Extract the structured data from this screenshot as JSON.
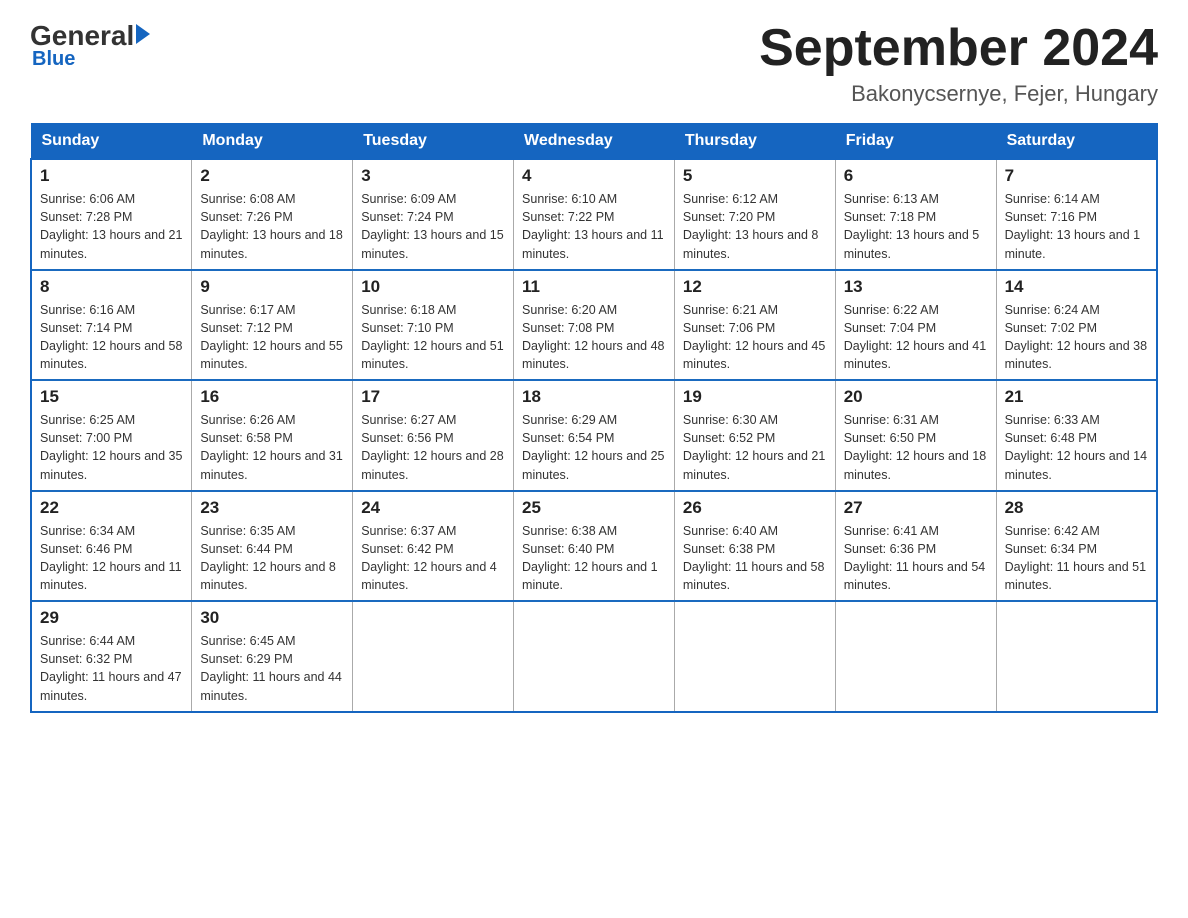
{
  "header": {
    "logo_main": "General",
    "logo_sub": "Blue",
    "title": "September 2024",
    "location": "Bakonycsernye, Fejer, Hungary"
  },
  "weekdays": [
    "Sunday",
    "Monday",
    "Tuesday",
    "Wednesday",
    "Thursday",
    "Friday",
    "Saturday"
  ],
  "weeks": [
    [
      {
        "day": "1",
        "sunrise": "6:06 AM",
        "sunset": "7:28 PM",
        "daylight": "13 hours and 21 minutes."
      },
      {
        "day": "2",
        "sunrise": "6:08 AM",
        "sunset": "7:26 PM",
        "daylight": "13 hours and 18 minutes."
      },
      {
        "day": "3",
        "sunrise": "6:09 AM",
        "sunset": "7:24 PM",
        "daylight": "13 hours and 15 minutes."
      },
      {
        "day": "4",
        "sunrise": "6:10 AM",
        "sunset": "7:22 PM",
        "daylight": "13 hours and 11 minutes."
      },
      {
        "day": "5",
        "sunrise": "6:12 AM",
        "sunset": "7:20 PM",
        "daylight": "13 hours and 8 minutes."
      },
      {
        "day": "6",
        "sunrise": "6:13 AM",
        "sunset": "7:18 PM",
        "daylight": "13 hours and 5 minutes."
      },
      {
        "day": "7",
        "sunrise": "6:14 AM",
        "sunset": "7:16 PM",
        "daylight": "13 hours and 1 minute."
      }
    ],
    [
      {
        "day": "8",
        "sunrise": "6:16 AM",
        "sunset": "7:14 PM",
        "daylight": "12 hours and 58 minutes."
      },
      {
        "day": "9",
        "sunrise": "6:17 AM",
        "sunset": "7:12 PM",
        "daylight": "12 hours and 55 minutes."
      },
      {
        "day": "10",
        "sunrise": "6:18 AM",
        "sunset": "7:10 PM",
        "daylight": "12 hours and 51 minutes."
      },
      {
        "day": "11",
        "sunrise": "6:20 AM",
        "sunset": "7:08 PM",
        "daylight": "12 hours and 48 minutes."
      },
      {
        "day": "12",
        "sunrise": "6:21 AM",
        "sunset": "7:06 PM",
        "daylight": "12 hours and 45 minutes."
      },
      {
        "day": "13",
        "sunrise": "6:22 AM",
        "sunset": "7:04 PM",
        "daylight": "12 hours and 41 minutes."
      },
      {
        "day": "14",
        "sunrise": "6:24 AM",
        "sunset": "7:02 PM",
        "daylight": "12 hours and 38 minutes."
      }
    ],
    [
      {
        "day": "15",
        "sunrise": "6:25 AM",
        "sunset": "7:00 PM",
        "daylight": "12 hours and 35 minutes."
      },
      {
        "day": "16",
        "sunrise": "6:26 AM",
        "sunset": "6:58 PM",
        "daylight": "12 hours and 31 minutes."
      },
      {
        "day": "17",
        "sunrise": "6:27 AM",
        "sunset": "6:56 PM",
        "daylight": "12 hours and 28 minutes."
      },
      {
        "day": "18",
        "sunrise": "6:29 AM",
        "sunset": "6:54 PM",
        "daylight": "12 hours and 25 minutes."
      },
      {
        "day": "19",
        "sunrise": "6:30 AM",
        "sunset": "6:52 PM",
        "daylight": "12 hours and 21 minutes."
      },
      {
        "day": "20",
        "sunrise": "6:31 AM",
        "sunset": "6:50 PM",
        "daylight": "12 hours and 18 minutes."
      },
      {
        "day": "21",
        "sunrise": "6:33 AM",
        "sunset": "6:48 PM",
        "daylight": "12 hours and 14 minutes."
      }
    ],
    [
      {
        "day": "22",
        "sunrise": "6:34 AM",
        "sunset": "6:46 PM",
        "daylight": "12 hours and 11 minutes."
      },
      {
        "day": "23",
        "sunrise": "6:35 AM",
        "sunset": "6:44 PM",
        "daylight": "12 hours and 8 minutes."
      },
      {
        "day": "24",
        "sunrise": "6:37 AM",
        "sunset": "6:42 PM",
        "daylight": "12 hours and 4 minutes."
      },
      {
        "day": "25",
        "sunrise": "6:38 AM",
        "sunset": "6:40 PM",
        "daylight": "12 hours and 1 minute."
      },
      {
        "day": "26",
        "sunrise": "6:40 AM",
        "sunset": "6:38 PM",
        "daylight": "11 hours and 58 minutes."
      },
      {
        "day": "27",
        "sunrise": "6:41 AM",
        "sunset": "6:36 PM",
        "daylight": "11 hours and 54 minutes."
      },
      {
        "day": "28",
        "sunrise": "6:42 AM",
        "sunset": "6:34 PM",
        "daylight": "11 hours and 51 minutes."
      }
    ],
    [
      {
        "day": "29",
        "sunrise": "6:44 AM",
        "sunset": "6:32 PM",
        "daylight": "11 hours and 47 minutes."
      },
      {
        "day": "30",
        "sunrise": "6:45 AM",
        "sunset": "6:29 PM",
        "daylight": "11 hours and 44 minutes."
      },
      null,
      null,
      null,
      null,
      null
    ]
  ]
}
